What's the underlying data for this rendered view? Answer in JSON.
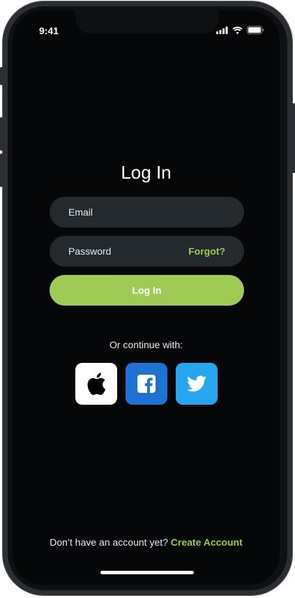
{
  "status_bar": {
    "time": "9:41"
  },
  "login": {
    "title": "Log In",
    "email_placeholder": "Email",
    "password_placeholder": "Password",
    "forgot_label": "Forgot?",
    "submit_label": "Log In"
  },
  "social": {
    "prompt": "Or continue with:",
    "buttons": [
      {
        "icon": "apple-icon",
        "bg": "#ffffff"
      },
      {
        "icon": "facebook-icon",
        "bg": "#1e73d2"
      },
      {
        "icon": "twitter-icon",
        "bg": "#27a6ef"
      }
    ]
  },
  "footer": {
    "prompt": "Don’t have an account yet?",
    "link_label": "Create Account"
  },
  "colors": {
    "accent": "#9ecb55",
    "field_bg": "#24292d",
    "screen_bg": "#050708"
  }
}
